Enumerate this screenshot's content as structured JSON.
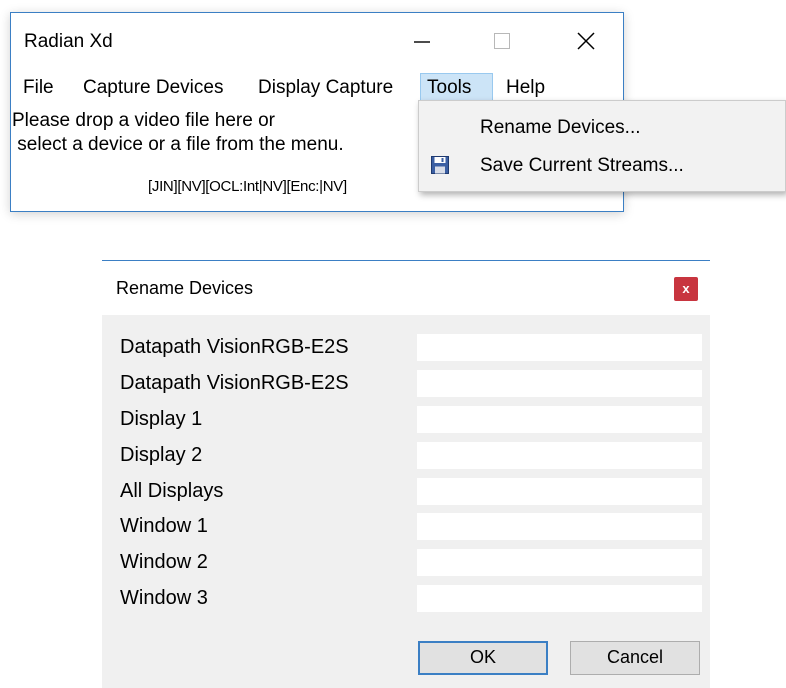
{
  "main_window": {
    "title": "Radian Xd",
    "menu": [
      "File",
      "Capture Devices",
      "Display Capture",
      "Tools",
      "Help"
    ],
    "active_menu": "Tools",
    "drop_text_line1": "Please drop a video file here or",
    "drop_text_line2": " select a device or a file from the menu.",
    "status_text": "[JIN][NV][OCL:Int|NV][Enc:|NV]"
  },
  "tools_menu": {
    "items": [
      {
        "label": "Rename Devices...",
        "icon": ""
      },
      {
        "label": "Save Current Streams...",
        "icon": "floppy-disk-icon"
      }
    ]
  },
  "rename_dialog": {
    "title": "Rename Devices",
    "close_label": "x",
    "devices": [
      {
        "label": "Datapath VisionRGB-E2S",
        "value": ""
      },
      {
        "label": "Datapath VisionRGB-E2S",
        "value": ""
      },
      {
        "label": "Display 1",
        "value": ""
      },
      {
        "label": "Display 2",
        "value": ""
      },
      {
        "label": "All Displays",
        "value": ""
      },
      {
        "label": "Window 1",
        "value": ""
      },
      {
        "label": "Window 2",
        "value": ""
      },
      {
        "label": "Window 3",
        "value": ""
      }
    ],
    "ok_label": "OK",
    "cancel_label": "Cancel"
  },
  "colors": {
    "accent": "#3b7fc4",
    "menu_highlight": "#cce4f7",
    "close_red": "#c8353f"
  }
}
